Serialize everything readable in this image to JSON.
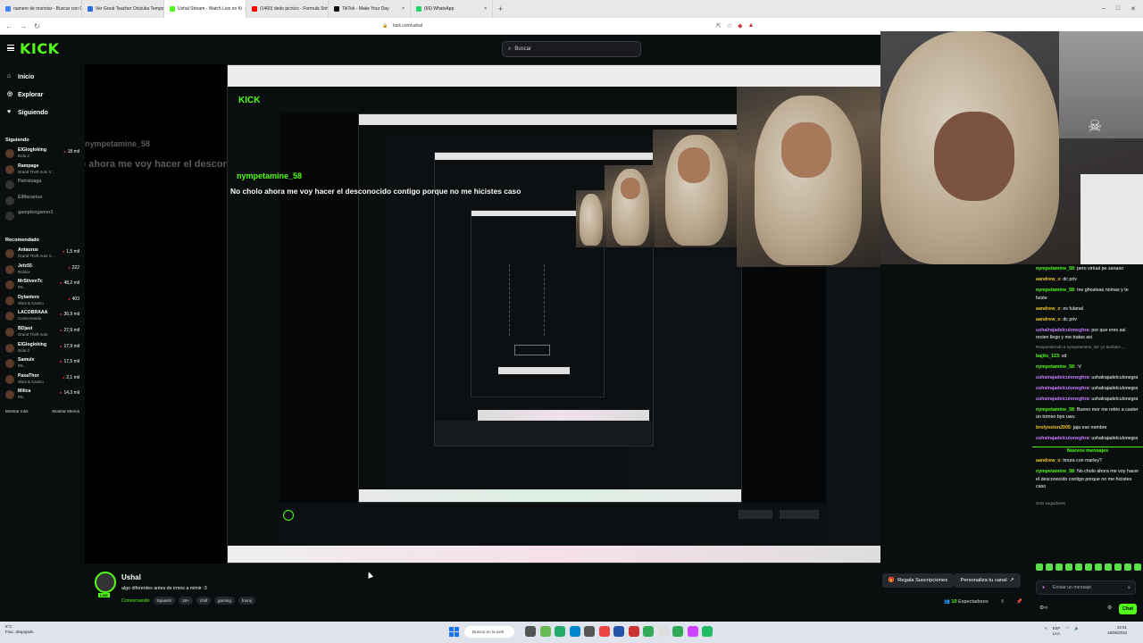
{
  "browser": {
    "tabs": [
      {
        "label": "numero de monstar - Buscar con Go",
        "color": "#4285f4"
      },
      {
        "label": "Ver Great Teacher Onizuka Tempora",
        "color": "#2d6cdf"
      },
      {
        "label": "Ushal Stream - Watch Live on Ki",
        "color": "#53fc18",
        "active": true
      },
      {
        "label": "(1460) dedo picnico - Formula Snivial Gl",
        "color": "#ff0000"
      },
      {
        "label": "TikTok - Make Your Day",
        "color": "#111111"
      },
      {
        "label": "(66) WhatsApp",
        "color": "#25d366"
      }
    ],
    "url": "kick.com/ushal"
  },
  "header": {
    "logo": "KICK",
    "search_placeholder": "Buscar"
  },
  "sidebar": {
    "nav": [
      {
        "label": "Inicio",
        "icon": "home-icon"
      },
      {
        "label": "Explorar",
        "icon": "compass-icon"
      },
      {
        "label": "Siguiendo",
        "icon": "heart-icon"
      }
    ],
    "following_title": "Siguiendo",
    "following": [
      {
        "name": "ElGlogloking",
        "game": "Dota 2",
        "viewers": "18 mil",
        "live": true
      },
      {
        "name": "Rampage",
        "game": "Grand Theft Auto V...",
        "viewers": "",
        "live": true
      },
      {
        "name": "Patratzaga",
        "game": "",
        "viewers": "",
        "live": false
      },
      {
        "name": "ElMacarius",
        "game": "",
        "viewers": "",
        "live": false
      },
      {
        "name": "gamplexgamer1",
        "game": "",
        "viewers": "",
        "live": false
      }
    ],
    "recommended_title": "Recomendado",
    "recommended": [
      {
        "name": "Antaurus",
        "game": "Grand Theft Auto V...",
        "viewers": "1,5 mil"
      },
      {
        "name": "Jefz55",
        "game": "Roblox",
        "viewers": "222"
      },
      {
        "name": "MrStivenTc",
        "game": "IRL",
        "viewers": "48,2 mil"
      },
      {
        "name": "Dylantero",
        "game": "Slots & Casino",
        "viewers": "403"
      },
      {
        "name": "LACOBRAAA",
        "game": "Conversando",
        "viewers": "36,9 mil"
      },
      {
        "name": "BDjavi",
        "game": "Grand Theft Auto",
        "viewers": "27,9 mil"
      },
      {
        "name": "ElGlogloking",
        "game": "Dota 2",
        "viewers": "17,9 mil"
      },
      {
        "name": "Samulx",
        "game": "IRL",
        "viewers": "17,5 mil"
      },
      {
        "name": "PaxaThor",
        "game": "Slots & Casino",
        "viewers": "2,1 mil"
      },
      {
        "name": "Milica",
        "game": "IRL",
        "viewers": "14,3 mil"
      }
    ],
    "show_more": "Mostrar más",
    "show_less": "Mostrar Menos"
  },
  "video": {
    "overlay_user": "nympetamine_58",
    "overlay_message": "No cholo ahora me voy hacer el desconocido contigo porque no me hicistes caso"
  },
  "chat": {
    "messages": [
      {
        "user": "nympetamine_58",
        "color": "#53fc18",
        "text": "pero virtual pe sanaso"
      },
      {
        "user": "aandrew_x",
        "color": "#f3c623",
        "text": "dc priv"
      },
      {
        "user": "nympetamine_58",
        "color": "#53fc18",
        "text": "me ghosteas nomas y te fuiste"
      },
      {
        "user": "aandrew_x",
        "color": "#f3c623",
        "text": "es fulanal"
      },
      {
        "user": "aandrew_x",
        "color": "#f3c623",
        "text": "dc priv"
      },
      {
        "user": "ushalrajadelculoneghra",
        "color": "#c77dff",
        "text": "por que eres asi recien llego y me tratas asi"
      },
      {
        "user": "",
        "color": "#999999",
        "text": "Respondiendo a nympetamine_58: yo tambien ..."
      },
      {
        "user": "bajito_123",
        "color": "#53fc18",
        "text": "xd"
      },
      {
        "user": "nympetamine_58",
        "color": "#53fc18",
        "text": ":V"
      },
      {
        "user": "ushalrajadelculoneghra",
        "color": "#c77dff",
        "text": "ushalrajadelculonegra"
      },
      {
        "user": "ushalrajadelculoneghra",
        "color": "#c77dff",
        "text": "ushalrajadelculonegra"
      },
      {
        "user": "ushalrajadelculoneghra",
        "color": "#c77dff",
        "text": "ushalrajadelculonegra"
      },
      {
        "user": "nympetamine_58",
        "color": "#53fc18",
        "text": "Bueno mor me retiro a caster un torneo bye uwu"
      },
      {
        "user": "brolyoslon2005",
        "color": "#f3c623",
        "text": "jaja ese nombre"
      },
      {
        "user": "ushalrajadelculoneghra",
        "color": "#c77dff",
        "text": "ushalrajadelculonegra"
      }
    ],
    "new_messages_label": "Nuevos mensajes",
    "new_messages": [
      {
        "user": "aandrew_x",
        "color": "#f3c623",
        "text": "lmura con marley?"
      },
      {
        "user": "nympetamine_58",
        "color": "#53fc18",
        "text": "No cholo ahora me voy hacer el desconocido contigo porque no me hicistes caso"
      }
    ],
    "followers_only": "Solo seguidores",
    "input_placeholder": "Enviar un mensaje",
    "send_label": "Chat"
  },
  "stream": {
    "name": "Ushal",
    "live_badge": "LIVE",
    "title": "algo diferentes antes de irmos a mimir :3",
    "category": "Conversando",
    "tags": [
      "Spanish",
      "18+",
      "chill",
      "gaming",
      "funny"
    ],
    "sub_button": "Regala Suscripciones",
    "customize_button": "Personaliza tu canal",
    "viewers_count": "10",
    "viewers_label": "Espectadores"
  },
  "taskbar": {
    "weather_temp": "8°C",
    "weather_desc": "Frac. despejado",
    "search_placeholder": "Buscar en la web",
    "lang": "ESP",
    "lang2": "LAA",
    "time": "22:51",
    "date": "18/06/2023"
  }
}
